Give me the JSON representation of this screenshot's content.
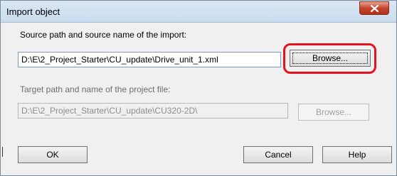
{
  "window": {
    "title": "Import object",
    "close_icon": "close-x-icon"
  },
  "source": {
    "label": "Source path and source name of the import:",
    "path": "D:\\E\\2_Project_Starter\\CU_update\\Drive_unit_1.xml",
    "browse_label": "Browse..."
  },
  "target": {
    "label": "Target path and name of the project file:",
    "path": "D:\\E\\2_Project_Starter\\CU_update\\CU320-2D\\",
    "browse_label": "Browse..."
  },
  "buttons": {
    "ok_label": "OK",
    "cancel_label": "Cancel",
    "help_label": "Help"
  },
  "annotation": {
    "highlight_color": "#e8121e"
  }
}
